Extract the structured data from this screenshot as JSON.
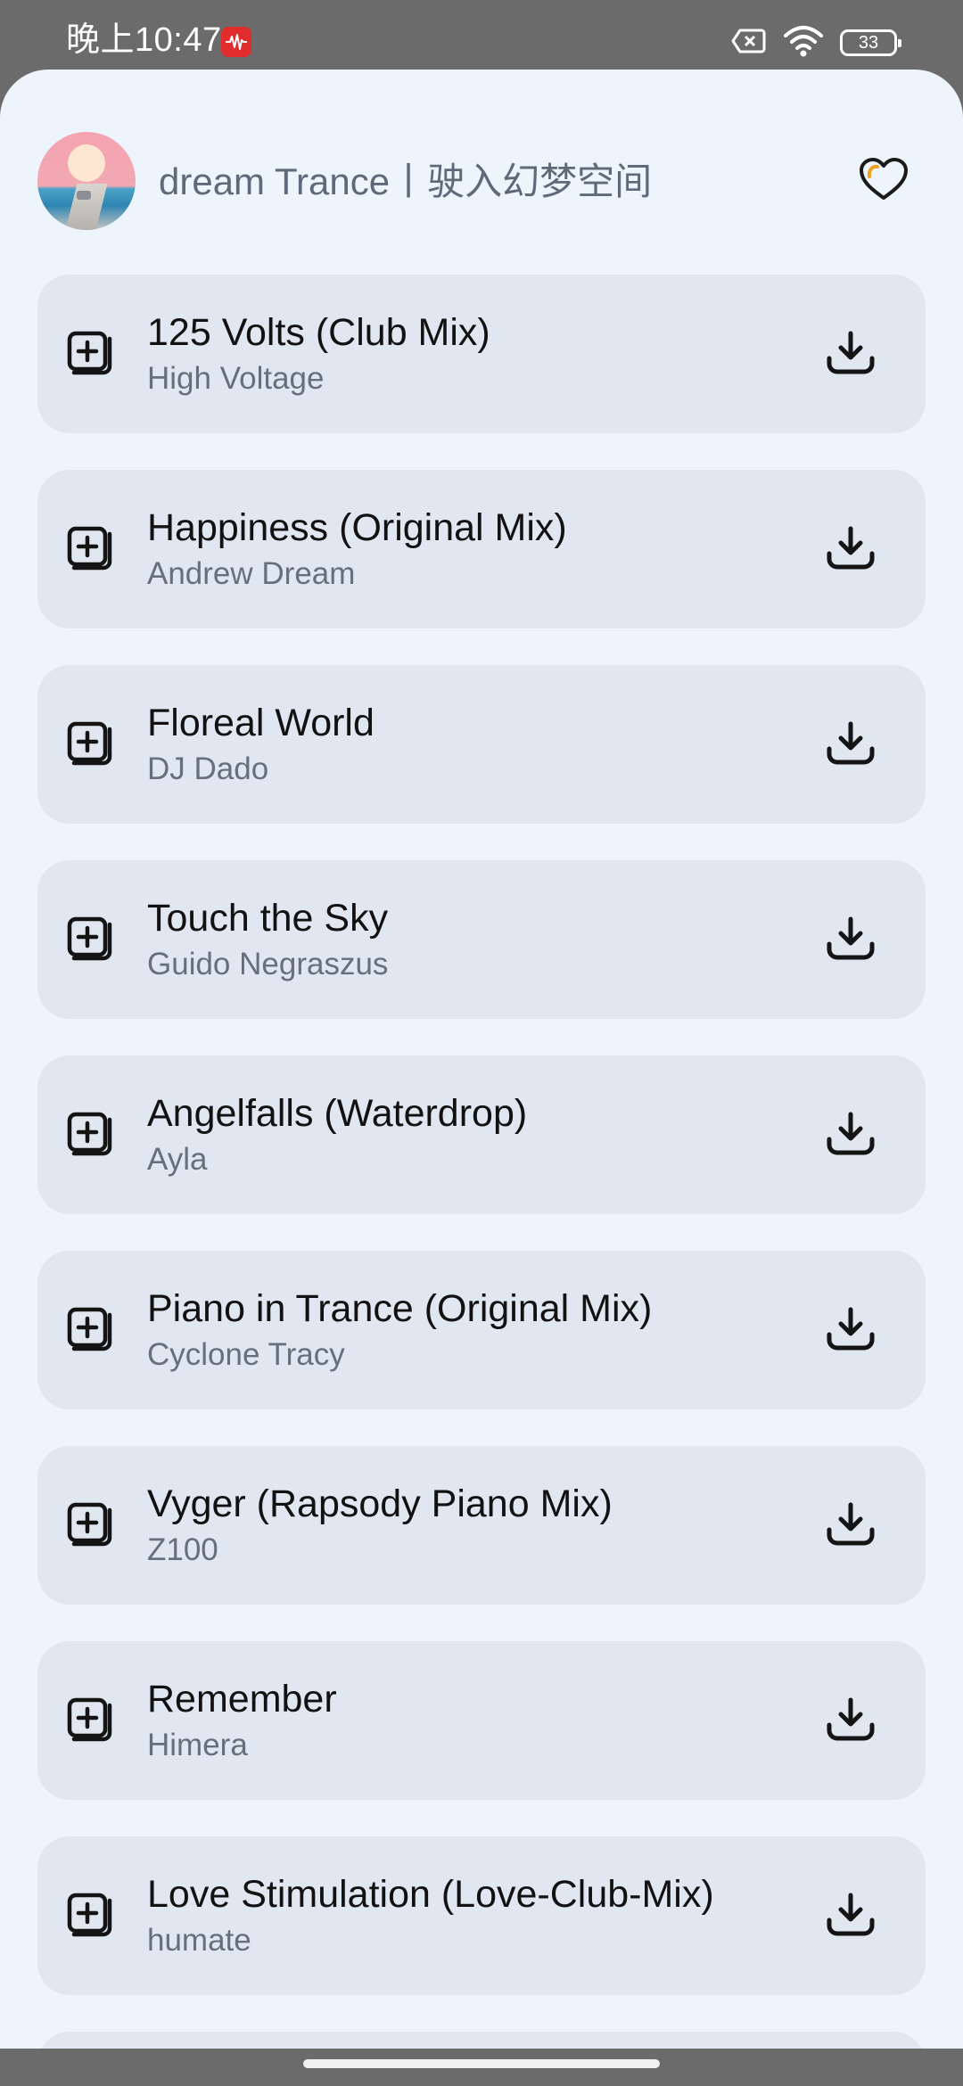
{
  "status_bar": {
    "time": "晚上10:47",
    "battery": "33",
    "app_icon": "sound-wave-icon",
    "icons": [
      "sim-off-icon",
      "wifi-icon",
      "battery-icon"
    ]
  },
  "header": {
    "title": "dream Trance丨驶入幻梦空间",
    "favorite_icon": "heart-icon"
  },
  "songs": [
    {
      "title": "125 Volts (Club Mix)",
      "artist": "High Voltage"
    },
    {
      "title": "Happiness (Original Mix)",
      "artist": "Andrew Dream"
    },
    {
      "title": "Floreal World",
      "artist": "DJ Dado"
    },
    {
      "title": "Touch the Sky",
      "artist": "Guido Negraszus"
    },
    {
      "title": "Angelfalls (Waterdrop)",
      "artist": "Ayla"
    },
    {
      "title": "Piano in Trance (Original Mix)",
      "artist": "Cyclone Tracy"
    },
    {
      "title": "Vyger (Rapsody Piano Mix)",
      "artist": "Z100"
    },
    {
      "title": "Remember",
      "artist": "Himera"
    },
    {
      "title": "Love Stimulation (Love-Club-Mix)",
      "artist": "humate"
    }
  ],
  "row_icons": {
    "add": "add-to-playlist-icon",
    "download": "download-icon"
  },
  "colors": {
    "background": "#eef4fc",
    "card": "#e1e7f0",
    "title_text": "#121212",
    "artist_text": "#66707c",
    "heart_accent": "#f0a020"
  }
}
